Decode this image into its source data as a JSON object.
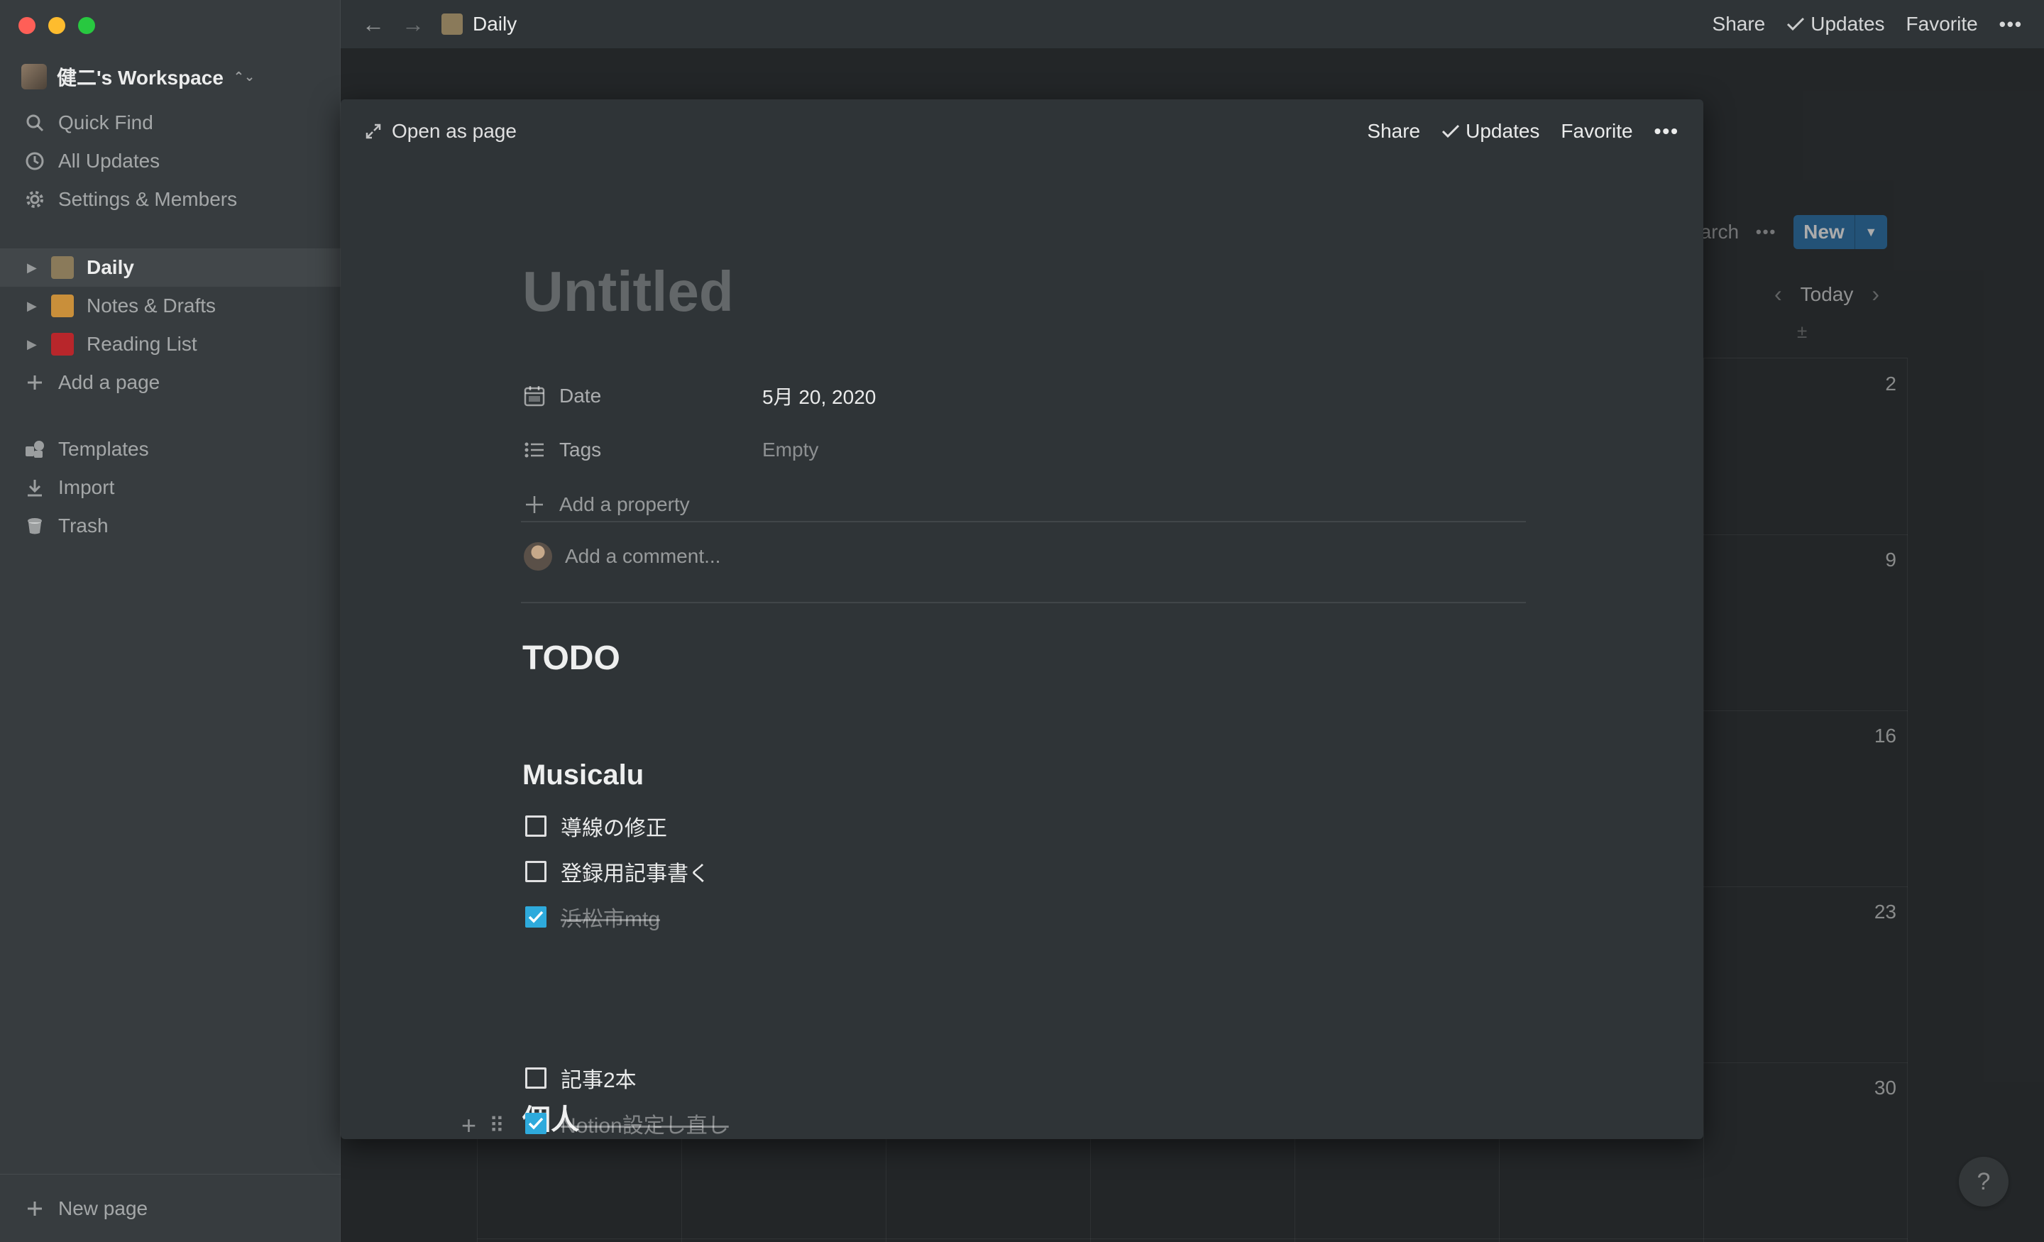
{
  "window": {
    "traffic_lights": [
      "close",
      "minimize",
      "zoom"
    ],
    "colors": {
      "close": "#ff5f57",
      "minimize": "#febc2e",
      "zoom": "#28c840"
    }
  },
  "sidebar": {
    "workspace_name": "健二's Workspace",
    "top_items": [
      {
        "label": "Quick Find",
        "icon": "search-icon"
      },
      {
        "label": "All Updates",
        "icon": "clock-icon"
      },
      {
        "label": "Settings & Members",
        "icon": "gear-icon"
      }
    ],
    "pages": [
      {
        "label": "Daily",
        "emoji": "📝",
        "active": true
      },
      {
        "label": "Notes & Drafts",
        "emoji": "✍️",
        "active": false
      },
      {
        "label": "Reading List",
        "emoji": "📕",
        "active": false
      }
    ],
    "add_page_label": "Add a page",
    "bottom_items": [
      {
        "label": "Templates",
        "icon": "templates-icon"
      },
      {
        "label": "Import",
        "icon": "import-icon"
      },
      {
        "label": "Trash",
        "icon": "trash-icon"
      }
    ],
    "new_page_label": "New page"
  },
  "topbar": {
    "breadcrumb": "Daily",
    "breadcrumb_emoji": "📝",
    "share_label": "Share",
    "updates_label": "Updates",
    "favorite_label": "Favorite",
    "more_label": "•••"
  },
  "background_calendar": {
    "search_partial": "earch",
    "more_label": "•••",
    "new_label": "New",
    "today_label": "Today",
    "day_numbers": [
      "2",
      "9",
      "16",
      "23",
      "30"
    ],
    "accent": "#2e77b0"
  },
  "modal": {
    "open_as_page_label": "Open as page",
    "share_label": "Share",
    "updates_label": "Updates",
    "favorite_label": "Favorite",
    "more_label": "•••",
    "title_placeholder": "Untitled",
    "properties": [
      {
        "name": "Date",
        "value": "5月 20, 2020",
        "icon": "calendar-icon",
        "empty": false
      },
      {
        "name": "Tags",
        "value": "Empty",
        "icon": "list-icon",
        "empty": true
      }
    ],
    "add_property_label": "Add a property",
    "comment_placeholder": "Add a comment...",
    "heading": "TODO",
    "sections": [
      {
        "title": "Musicalu",
        "todos": [
          {
            "text": "導線の修正",
            "checked": false
          },
          {
            "text": "登録用記事書く",
            "checked": false
          },
          {
            "text": "浜松市mtg",
            "checked": true
          }
        ]
      },
      {
        "title": "個人",
        "todos": [
          {
            "text": "記事2本",
            "checked": false
          },
          {
            "text": "Notion設定し直し",
            "checked": true
          }
        ]
      }
    ],
    "checkbox_color": "#2eaadc"
  },
  "help_label": "?"
}
